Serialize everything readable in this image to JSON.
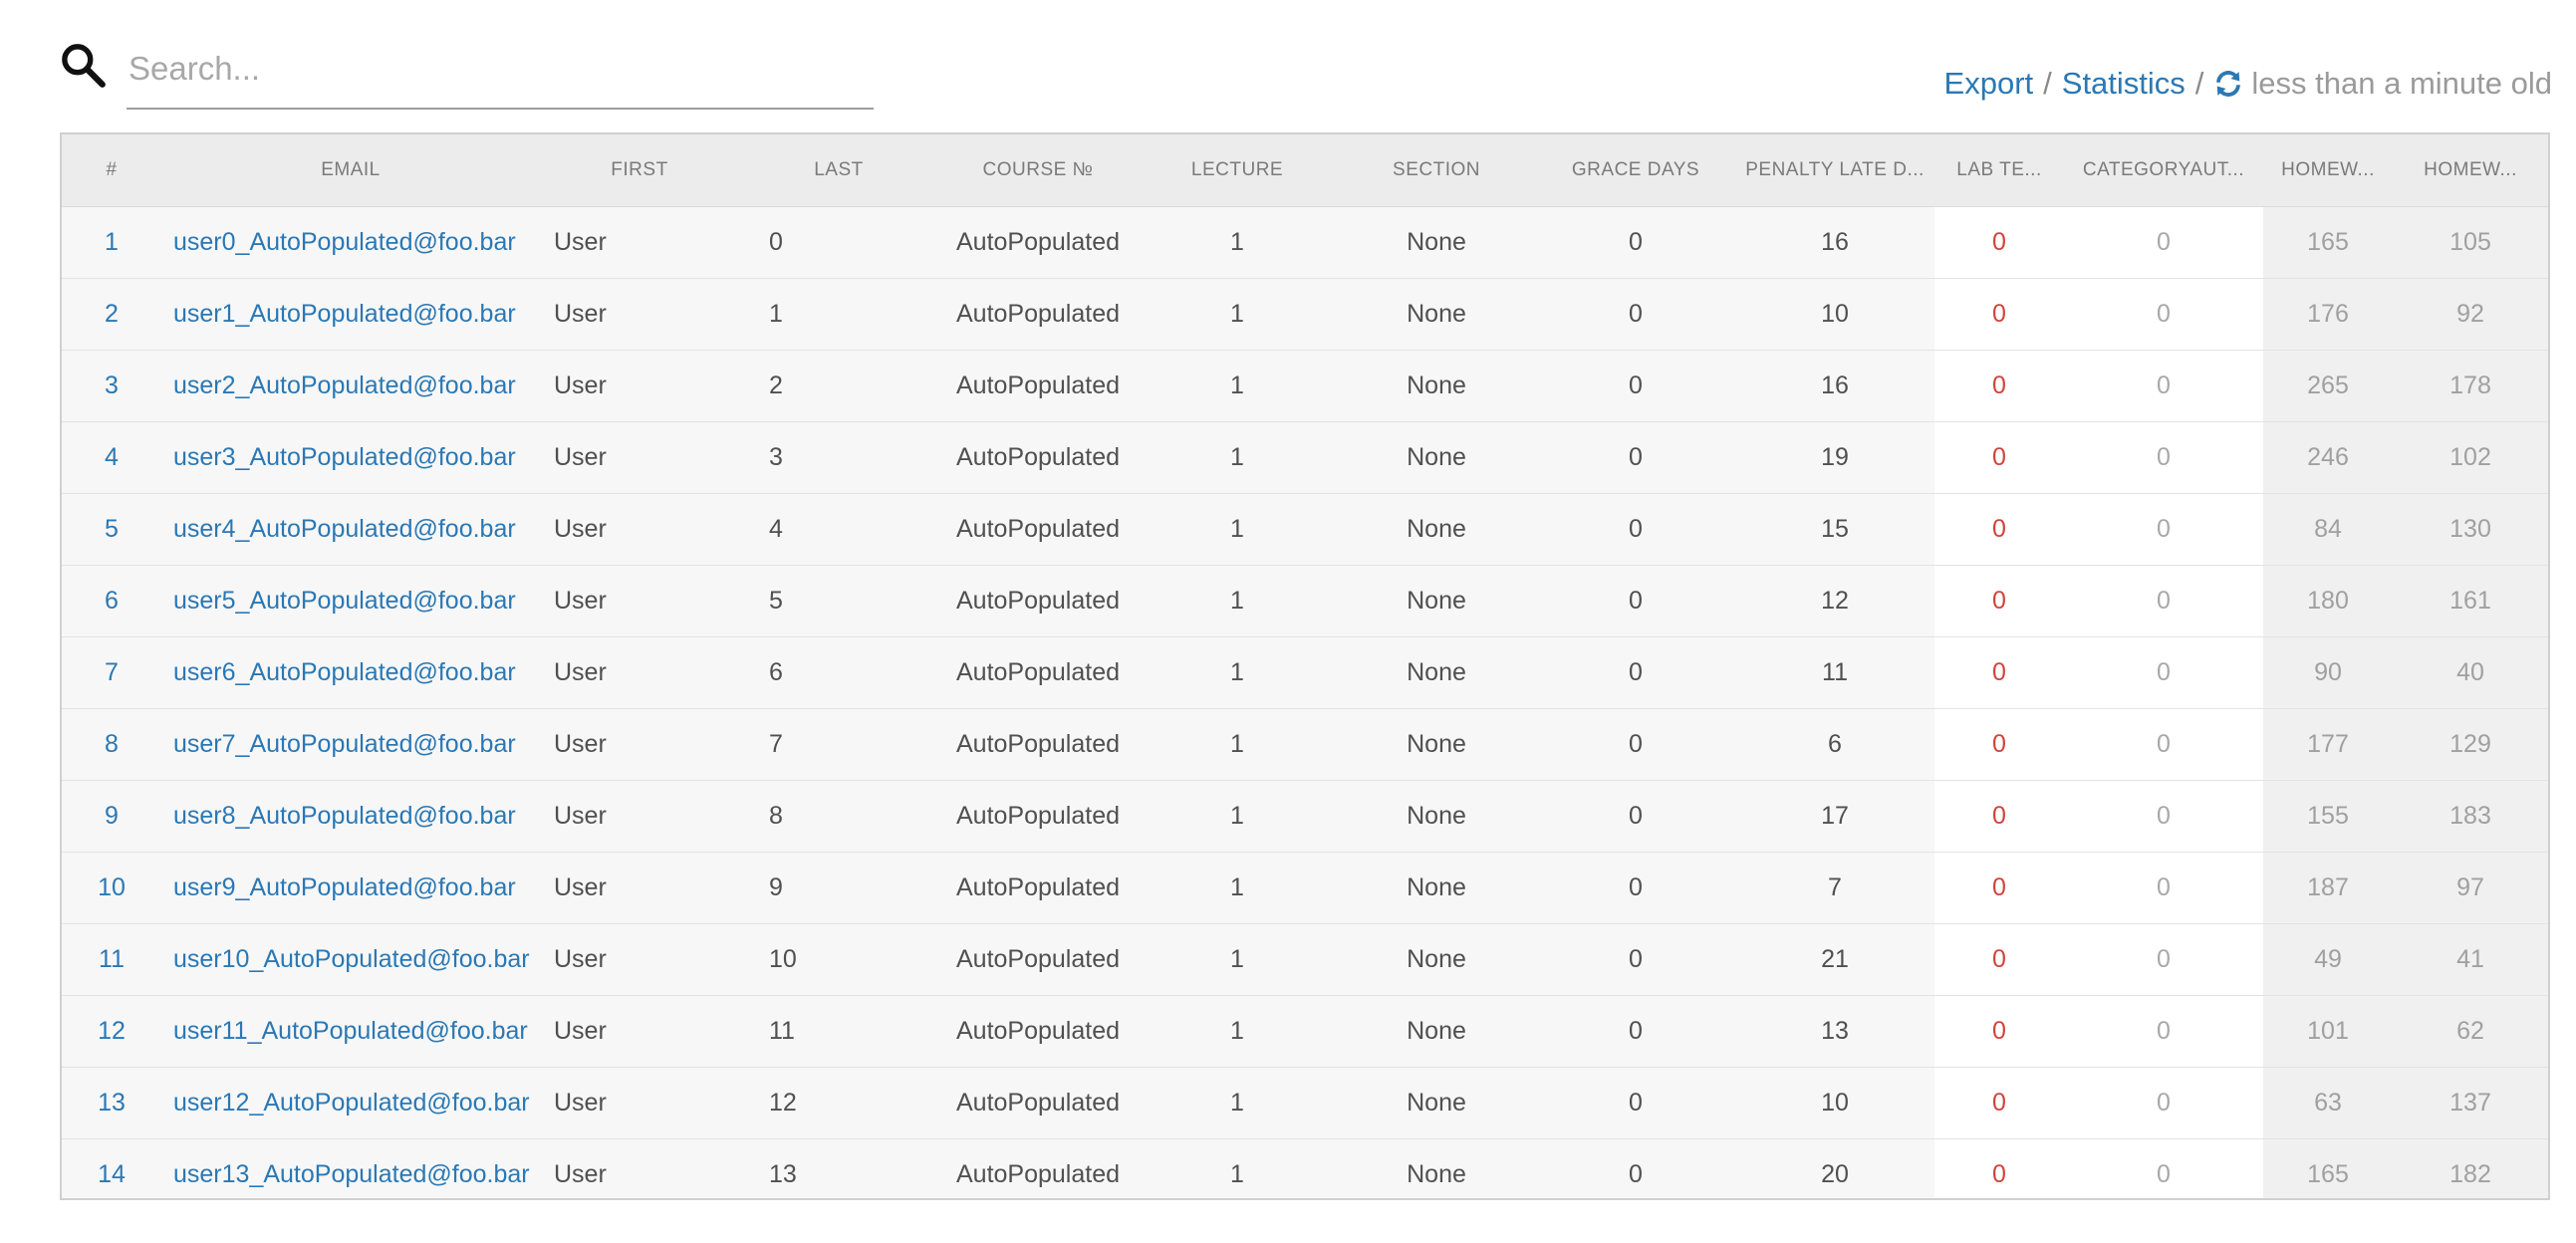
{
  "search": {
    "placeholder": "Search..."
  },
  "toolbar": {
    "export_label": "Export",
    "statistics_label": "Statistics",
    "separator": "/",
    "refresh_status": "less than a minute old",
    "link_color": "#2b78b4"
  },
  "table": {
    "columns": [
      "#",
      "EMAIL",
      "FIRST",
      "LAST",
      "COURSE №",
      "LECTURE",
      "SECTION",
      "GRACE DAYS",
      "PENALTY LATE D...",
      "LAB TE...",
      "CATEGORYAUT...",
      "HOMEW...",
      "HOMEW..."
    ],
    "rows": [
      [
        "1",
        "user0_AutoPopulated@foo.bar",
        "User",
        "0",
        "AutoPopulated",
        "1",
        "None",
        "0",
        "16",
        "0",
        "0",
        "165",
        "105"
      ],
      [
        "2",
        "user1_AutoPopulated@foo.bar",
        "User",
        "1",
        "AutoPopulated",
        "1",
        "None",
        "0",
        "10",
        "0",
        "0",
        "176",
        "92"
      ],
      [
        "3",
        "user2_AutoPopulated@foo.bar",
        "User",
        "2",
        "AutoPopulated",
        "1",
        "None",
        "0",
        "16",
        "0",
        "0",
        "265",
        "178"
      ],
      [
        "4",
        "user3_AutoPopulated@foo.bar",
        "User",
        "3",
        "AutoPopulated",
        "1",
        "None",
        "0",
        "19",
        "0",
        "0",
        "246",
        "102"
      ],
      [
        "5",
        "user4_AutoPopulated@foo.bar",
        "User",
        "4",
        "AutoPopulated",
        "1",
        "None",
        "0",
        "15",
        "0",
        "0",
        "84",
        "130"
      ],
      [
        "6",
        "user5_AutoPopulated@foo.bar",
        "User",
        "5",
        "AutoPopulated",
        "1",
        "None",
        "0",
        "12",
        "0",
        "0",
        "180",
        "161"
      ],
      [
        "7",
        "user6_AutoPopulated@foo.bar",
        "User",
        "6",
        "AutoPopulated",
        "1",
        "None",
        "0",
        "11",
        "0",
        "0",
        "90",
        "40"
      ],
      [
        "8",
        "user7_AutoPopulated@foo.bar",
        "User",
        "7",
        "AutoPopulated",
        "1",
        "None",
        "0",
        "6",
        "0",
        "0",
        "177",
        "129"
      ],
      [
        "9",
        "user8_AutoPopulated@foo.bar",
        "User",
        "8",
        "AutoPopulated",
        "1",
        "None",
        "0",
        "17",
        "0",
        "0",
        "155",
        "183"
      ],
      [
        "10",
        "user9_AutoPopulated@foo.bar",
        "User",
        "9",
        "AutoPopulated",
        "1",
        "None",
        "0",
        "7",
        "0",
        "0",
        "187",
        "97"
      ],
      [
        "11",
        "user10_AutoPopulated@foo.bar",
        "User",
        "10",
        "AutoPopulated",
        "1",
        "None",
        "0",
        "21",
        "0",
        "0",
        "49",
        "41"
      ],
      [
        "12",
        "user11_AutoPopulated@foo.bar",
        "User",
        "11",
        "AutoPopulated",
        "1",
        "None",
        "0",
        "13",
        "0",
        "0",
        "101",
        "62"
      ],
      [
        "13",
        "user12_AutoPopulated@foo.bar",
        "User",
        "12",
        "AutoPopulated",
        "1",
        "None",
        "0",
        "10",
        "0",
        "0",
        "63",
        "137"
      ],
      [
        "14",
        "user13_AutoPopulated@foo.bar",
        "User",
        "13",
        "AutoPopulated",
        "1",
        "None",
        "0",
        "20",
        "0",
        "0",
        "165",
        "182"
      ]
    ]
  },
  "colors": {
    "accent": "#2b78b4",
    "zero_highlight": "#d0443c",
    "muted": "#a0a0a0"
  },
  "icons": {
    "search": "search-icon",
    "refresh": "refresh-icon"
  }
}
